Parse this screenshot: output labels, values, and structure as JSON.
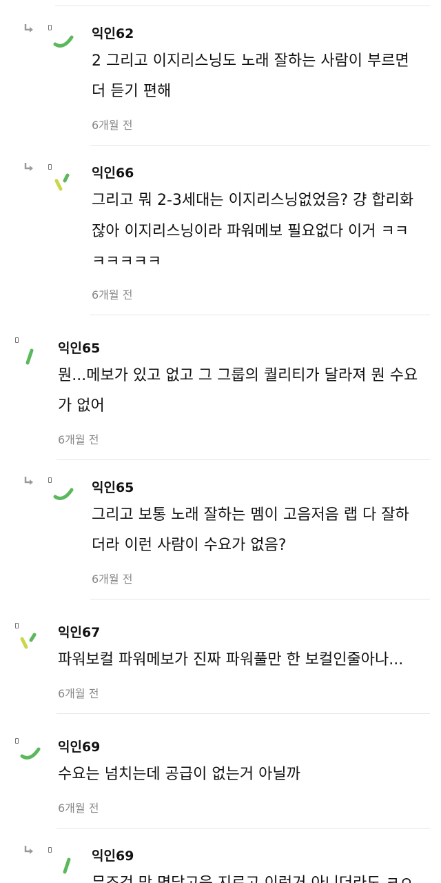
{
  "comments": [
    {
      "nickname": "익인62",
      "lines": [
        "2 그리고 이지리스닝도 노래 잘하는 사람이 부르면",
        "더 듣기 편해"
      ],
      "time": "6개월 전"
    },
    {
      "nickname": "익인66",
      "lines": [
        "그리고 뭐 2-3세대는 이지리스닝없었음? 걍 합리화",
        "잖아 이지리스닝이라 파워메보 필요없다 이거 ㅋㅋ",
        "ㅋㅋㅋㅋㅋ"
      ],
      "time": "6개월 전"
    },
    {
      "nickname": "익인65",
      "lines": [
        "뭔...메보가 있고 없고 그 그룹의 퀄리티가 달라져 뭔 수요",
        "가 없어"
      ],
      "time": "6개월 전"
    },
    {
      "nickname": "익인65",
      "lines": [
        "그리고 보통 노래 잘하는 멤이 고음저음 랩 다 잘하",
        "더라 이런 사람이 수요가 없음?"
      ],
      "time": "6개월 전"
    },
    {
      "nickname": "익인67",
      "lines": [
        "파워보컬 파워메보가 진짜 파워풀만 한 보컬인줄아나..."
      ],
      "time": "6개월 전"
    },
    {
      "nickname": "익인69",
      "lines": [
        "수요는 넘치는데 공급이 없는거 아닐까"
      ],
      "time": "6개월 전"
    },
    {
      "nickname": "익인69",
      "lines": [
        "무조건 막 면닫고음 지르고 이런거 아니더라도 ㅋㅇ"
      ],
      "time": ""
    }
  ],
  "colors": {
    "avatar_green": "#5cb85c",
    "avatar_yellow": "#c9d84a",
    "divider": "#e6e6e6",
    "time_text": "#888888"
  },
  "icons": {
    "reply": "reply-arrow-icon",
    "avatar": "avatar-icon"
  }
}
